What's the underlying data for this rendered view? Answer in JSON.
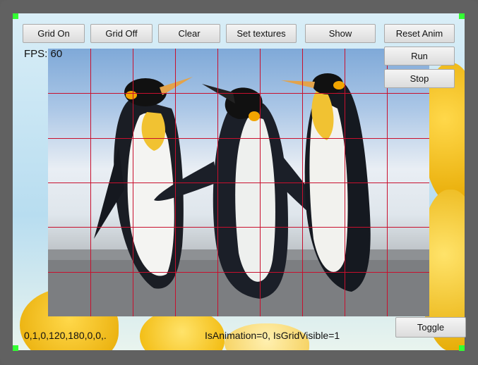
{
  "toolbar": {
    "buttons": [
      "Grid On",
      "Grid Off",
      "Clear",
      "Set textures",
      "Show",
      "Reset Anim"
    ],
    "run_label": "Run",
    "stop_label": "Stop",
    "toggle_label": "Toggle"
  },
  "status": {
    "fps": "FPS: 60",
    "values": "0,1,0,120,180,0,0,.",
    "state": "IsAnimation=0, IsGridVisible=1"
  },
  "scene": {
    "picture_subject": "penguins",
    "grid_columns": 9,
    "grid_rows": 6,
    "grid_color": "#c8102e",
    "corner_marker_color": "#33ff33"
  }
}
